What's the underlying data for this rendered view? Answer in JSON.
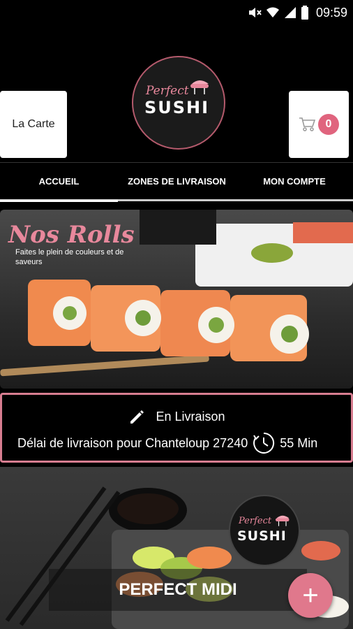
{
  "status_bar": {
    "time": "09:59"
  },
  "header": {
    "carte_label": "La Carte",
    "cart_count": "0",
    "logo": {
      "perfect": "Perfect",
      "sushi": "SUSHI"
    }
  },
  "nav": {
    "tabs": [
      {
        "label": "ACCUEIL",
        "active": true
      },
      {
        "label": "ZONES DE LIVRAISON"
      },
      {
        "label": "MON COMPTE"
      }
    ]
  },
  "banner": {
    "title": "Nos Rolls",
    "subtitle": "Faites le plein de couleurs et de saveurs"
  },
  "delivery": {
    "mode": "En Livraison",
    "delay_text": "Délai de livraison pour Chanteloup 27240",
    "duration": "55 Min"
  },
  "card": {
    "title": "PERFECT MIDI",
    "logo": {
      "perfect": "Perfect",
      "sushi": "SUSHI"
    },
    "fab_label": "+"
  },
  "colors": {
    "accent": "#e0788c",
    "background": "#000000"
  }
}
